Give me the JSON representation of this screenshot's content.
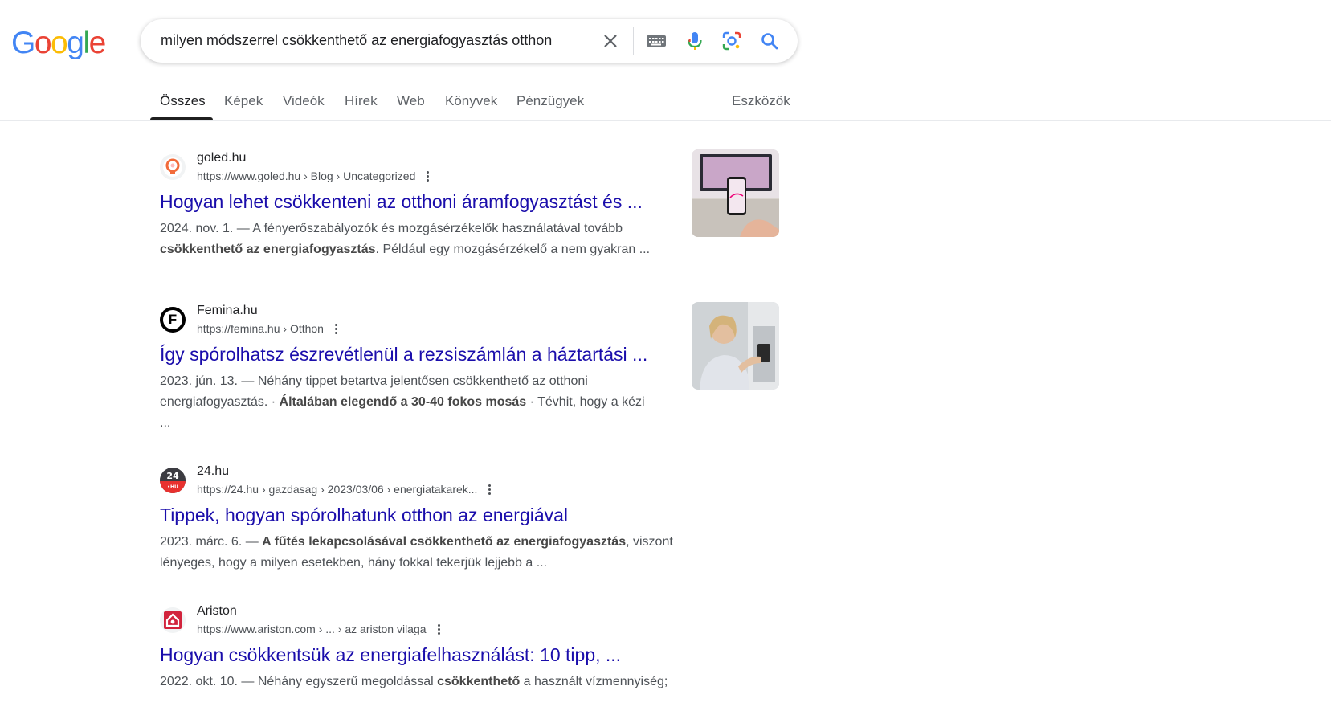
{
  "logo": {
    "g": "G",
    "o1": "o",
    "o2": "o",
    "g2": "g",
    "l": "l",
    "e": "e"
  },
  "search": {
    "query": "milyen módszerrel csökkenthető az energiafogyasztás otthon"
  },
  "tabs": [
    {
      "label": "Összes",
      "active": true
    },
    {
      "label": "Képek"
    },
    {
      "label": "Videók"
    },
    {
      "label": "Hírek"
    },
    {
      "label": "Web"
    },
    {
      "label": "Könyvek"
    },
    {
      "label": "Pénzügyek"
    }
  ],
  "tools": "Eszközök",
  "results": [
    {
      "site": "goled.hu",
      "url": "https://www.goled.hu › Blog › Uncategorized",
      "title": "Hogyan lehet csökkenteni az otthoni áramfogyasztást és ...",
      "date": "2024. nov. 1. — ",
      "s1": "A fényerőszabályozók és mozgásérzékelők használatával tovább ",
      "s1b": "csökkenthető az energiafogyasztás",
      "s2": ". Például egy mozgásérzékelő a nem gyakran ..."
    },
    {
      "site": "Femina.hu",
      "url": "https://femina.hu › Otthon",
      "title": "Így spórolhatsz észrevétlenül a rezsiszámlán a háztartási ...",
      "date": "2023. jún. 13. — ",
      "s1": "Néhány tippet betartva jelentősen csökkenthető az otthoni energiafogyasztás. · ",
      "s1b": "Általában elegendő a 30-40 fokos mosás",
      "s2": " · Tévhit, hogy a kézi ..."
    },
    {
      "site": "24.hu",
      "url": "https://24.hu › gazdasag › 2023/03/06 › energiatakarek...",
      "title": "Tippek, hogyan spórolhatunk otthon az energiával",
      "date": "2023. márc. 6. — ",
      "s1": "",
      "s1b": "A fűtés lekapcsolásával csökkenthető az energiafogyasztás",
      "s2": ", viszont lényeges, hogy a milyen esetekben, hány fokkal tekerjük lejjebb a ..."
    },
    {
      "site": "Ariston",
      "url": "https://www.ariston.com › ... › az ariston vilaga",
      "title": "Hogyan csökkentsük az energiafelhasználást: 10 tipp, ...",
      "date": "2022. okt. 10. — ",
      "s1": "Néhány egyszerű megoldással ",
      "s1b": "csökkenthető",
      "s2": " a használt vízmennyiség;"
    }
  ],
  "favicons": {
    "femina": "F",
    "h24": "24",
    "h24b": "•HU"
  }
}
